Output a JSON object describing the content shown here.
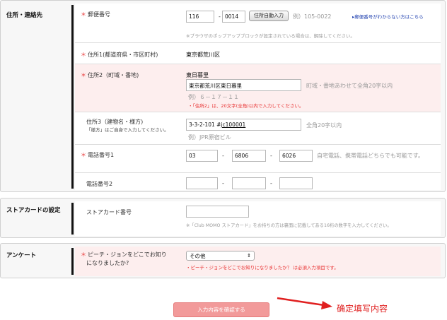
{
  "address_section": {
    "label": "住所・連絡先",
    "postal": {
      "label": "郵便番号",
      "part1": "116",
      "dash": "-",
      "part2": "0014",
      "auto_button": "住所自動入力",
      "example": "例）105-0022",
      "unknown_link": "▸郵便番号がわからない方はこちら",
      "popup_note": "※ブラウザのポップアップブロックが設定されている場合は、解除してください。"
    },
    "address1": {
      "label": "住所1(都道府県・市区町村)",
      "value": "東京都荒川区"
    },
    "address2": {
      "label": "住所2（町域・番地)",
      "static_value": "東日暮里",
      "input_value": "東京都荒川区東日暮里",
      "hint": "町域・番地あわせて全角20字以内",
      "example": "例）６－１７－１１",
      "error": "・「住所2」は、20文字(全角)以内で入力してください。"
    },
    "address3": {
      "label": "住所3（建物名・様方)",
      "note": "「様方」はご自身で入力してください。",
      "input_prefix": "3-3-2-101 #",
      "input_underlined": "jc100001",
      "hint": "全角20字以内",
      "example": "例）JPR原宿ビル"
    },
    "phone1": {
      "label": "電話番号1",
      "part1": "03",
      "part2": "6806",
      "part3": "6026",
      "dash": "-",
      "hint": "自宅電話、携帯電話どちらでも可能です。"
    },
    "phone2": {
      "label": "電話番号2",
      "part1": "",
      "part2": "",
      "part3": "",
      "dash": "-"
    }
  },
  "store_card_section": {
    "label": "ストアカードの設定",
    "field_label": "ストアカード番号",
    "value": "",
    "note": "※「Club MOMO ストアカード」をお持ちの方は裏面に記載してある16桁の数字を入力してください。"
  },
  "survey_section": {
    "label": "アンケート",
    "question_line1": "ピーチ・ジョンをどこでお知り",
    "question_line2": "になりましたか?",
    "selected": "その他",
    "select_arrow": "⇕",
    "error": "・ピーチ・ジョンをどこでお知りになりましたか？ は必須入力項目です。"
  },
  "required_mark": "＊",
  "confirm_button": "入力内容を確認する",
  "annotation": {
    "text": "确定填写内容",
    "arrow_color": "#e02020"
  },
  "colors": {
    "required": "#e83030",
    "error_bg": "#fdeeee",
    "confirm_bg": "#f29a9a",
    "link": "#2343b0"
  }
}
